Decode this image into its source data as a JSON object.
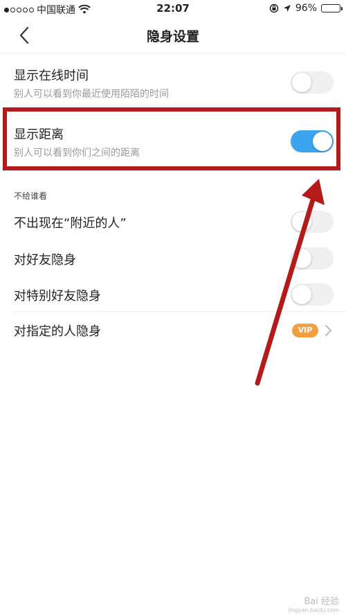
{
  "status": {
    "carrier": "中国联通",
    "time": "22:07",
    "battery": "96%",
    "battery_level": 0.96
  },
  "nav": {
    "title": "隐身设置"
  },
  "settings": [
    {
      "title": "显示在线时间",
      "subtitle": "别人可以看到你最近使用陌陌的时间",
      "enabled": false
    },
    {
      "title": "显示距离",
      "subtitle": "别人可以看到你们之间的距离",
      "enabled": true
    }
  ],
  "section": {
    "label": "不给谁看"
  },
  "hide_items": [
    {
      "title": "不出现在“附近的人”",
      "enabled": false
    },
    {
      "title": "对好友隐身",
      "enabled": false
    },
    {
      "title": "对特别好友隐身",
      "enabled": false
    }
  ],
  "specified": {
    "title": "对指定的人隐身",
    "badge": "VIP"
  },
  "colors": {
    "toggle_on": "#3aa4f0",
    "highlight": "#b41a1a",
    "vip": "#f0a040"
  },
  "watermark": {
    "text": "Bai 经验",
    "sub": "jingyan.baidu.com"
  }
}
